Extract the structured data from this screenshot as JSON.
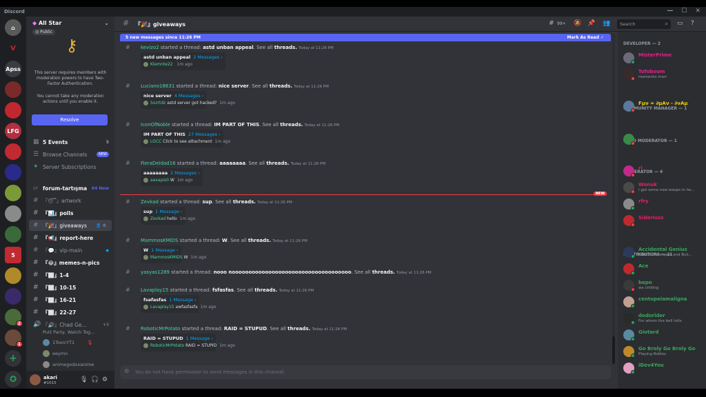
{
  "window": {
    "title": "Discord",
    "controls": [
      "—",
      "☐",
      "✕"
    ]
  },
  "server": {
    "name": "All Star",
    "visibility": "Public"
  },
  "rail": [
    {
      "label": "",
      "color": "#5a5a5a",
      "icon": "server-logo-icon"
    },
    {
      "label": "Apss",
      "color": "#3a3c42"
    },
    {
      "label": "",
      "color": "#7a2a2a"
    },
    {
      "label": "",
      "color": "#c0282f"
    },
    {
      "label": "LFG",
      "color": "#b03040"
    },
    {
      "label": "",
      "color": "#c02a30"
    },
    {
      "label": "",
      "color": "#2a2a8a"
    },
    {
      "label": "",
      "color": "#7a9a3a"
    },
    {
      "label": "",
      "color": "#8a8a8a"
    },
    {
      "label": "",
      "color": "#3a6a3a"
    },
    {
      "label": "5",
      "color": "#c02a30"
    },
    {
      "label": "",
      "color": "#b08a2a"
    },
    {
      "label": "",
      "color": "#3a2a6a"
    },
    {
      "label": "",
      "color": "#4a6a3a"
    },
    {
      "label": "",
      "color": "#6a4a3a"
    }
  ],
  "notice": {
    "text1": "This server requires members with moderation powers to have Two-Factor Authentication.",
    "text2": "You cannot take any moderation actions until you enable it.",
    "button": "Resolve"
  },
  "channels": {
    "events": {
      "label": "5 Events",
      "count": "5"
    },
    "browse": {
      "label": "Browse Channels",
      "tag": "NEW"
    },
    "subs": {
      "label": "Server Subscriptions"
    },
    "list": [
      {
        "name": "forum-tartışma",
        "tag": "64 New"
      },
      {
        "name": "『😴』artwork"
      },
      {
        "name": "『📊』polls"
      },
      {
        "name": "『🎉』giveaways"
      },
      {
        "name": "『📢』report-here"
      },
      {
        "name": "『💬』vip-main"
      },
      {
        "name": "『😂』memes-n-pics"
      },
      {
        "name": "『⬜』1-4"
      },
      {
        "name": "『⬜』10-15"
      },
      {
        "name": "『⬜』16-21"
      },
      {
        "name": "『⬜』22-27"
      },
      {
        "name": "『🔊』Chad Ge..."
      }
    ],
    "voice_sub": "Putt Party, Watch Tog...",
    "voice_count": "+3",
    "voice_users": [
      "1ToxicYT1",
      "eeymn",
      "animegodxxanime"
    ]
  },
  "user": {
    "name": "akari",
    "tag": "#1015"
  },
  "chat": {
    "channel": "『🎉』giveaways",
    "header_badge": "99+",
    "search_placeholder": "Search",
    "new_messages": "5 new messages since 11:26 PM",
    "mark_read": "Mark As Read",
    "composer_placeholder": "You do not have permission to send messages in this channel.",
    "new_divider": "NEW",
    "messages": [
      {
        "user": "kevizo2",
        "thread": "astd unban appeal",
        "card_title": "astd unban appeal",
        "count": "2 Messages ›",
        "last_user": "Klemnte22",
        "last_text": "",
        "last_time": "1m ago"
      },
      {
        "user": "Luciano18631",
        "thread": "nice server",
        "card_title": "nice server",
        "count": "4 Messages ›",
        "last_user": "Sxzrtdz",
        "last_text": "astd server got hacked?",
        "last_time": "1m ago"
      },
      {
        "user": "IconOfNoble",
        "thread": "IM PART OF THIS",
        "card_title": "IM PART OF THIS",
        "count": "27 Messages ›",
        "last_user": "LOCC",
        "last_text": "Click to see attachment",
        "last_time": "1m ago"
      },
      {
        "user": "FieraDeidad16",
        "thread": "aaaaaaaa",
        "card_title": "aaaaaaaa",
        "count": "2 Messages ›",
        "last_user": "aaxapis0",
        "last_text": "W",
        "last_time": "1m ago"
      },
      {
        "user": "Zevkad",
        "thread": "sup",
        "card_title": "sup",
        "count": "1 Message ›",
        "last_user": "Zevkad",
        "last_text": "hello",
        "last_time": "1m ago"
      },
      {
        "user": "MammosKMIDS",
        "thread": "W",
        "card_title": "W",
        "count": "1 Message ›",
        "last_user": "MammosKMIDS",
        "last_text": "W",
        "last_time": "1m ago"
      },
      {
        "user": "yasyas1289",
        "thread": "nooo noooooooooooooooooooooooooooooooooooo",
        "card_title": "",
        "count": "",
        "last_user": "",
        "last_text": "",
        "last_time": ""
      },
      {
        "user": "Lavaplay15",
        "thread": "fsfasfas",
        "card_title": "fsafasfas",
        "count": "1 Message ›",
        "last_user": "Lavaplay15",
        "last_text": "awfasfasfa",
        "last_time": "1m ago"
      },
      {
        "user": "RoboticMrPotato",
        "thread": "RAID = STUPUD",
        "card_title": "RAID = STUPUD",
        "count": "1 Message ›",
        "last_user": "RoboticMrPotato",
        "last_text": "RAID = STUPID",
        "last_time": "1m ago"
      }
    ],
    "started": "started a thread:",
    "see_all": "See all",
    "threads": "threads.",
    "timestamp": "Today at 11:26 PM"
  },
  "members": {
    "categories": {
      "developer": "DEVELOPER — 2",
      "community": "COMMUNITY MANAGER — 1",
      "head_mod": "HEAD MODERATOR — 1",
      "moderator": "MODERATOR — 4",
      "contributors": "CONTRIBUTORS — 21"
    },
    "list": [
      {
        "name": "MisterPrime",
        "status": "",
        "color": "#e91e8c",
        "av": "#6a6a7a"
      },
      {
        "name": "Tofoboom",
        "status": "memento mori",
        "color": "#e91e8c",
        "av": "#3a2a2a"
      },
      {
        "name": "Fμν = ∂μAν - ∂νAμ",
        "status": "",
        "color": "#f0d000",
        "av": "#5a7a9a"
      },
      {
        "name": "",
        "status": "",
        "color": "#e91e8c",
        "av": "#3a8a4a"
      },
      {
        "name": "ri",
        "status": "",
        "color": "#e91e63",
        "av": "#c02a8a"
      },
      {
        "name": "Wonuk ",
        "status": "I got some new wasps in he...",
        "color": "#e91e63",
        "av": "#4a4a4a"
      },
      {
        "name": "rfry",
        "status": "",
        "color": "#e91e63",
        "av": "#8a8a8a"
      },
      {
        "name": "Sideriuss",
        "status": "",
        "color": "#e91e63",
        "av": "#c0282f"
      },
      {
        "name": "Accidental Genius",
        "status": "Roblox Developer and Buil...",
        "color": "#3ba55d",
        "av": "#2a3a5a"
      },
      {
        "name": "Ace",
        "status": "",
        "color": "#3ba55d",
        "av": "#c0282f"
      },
      {
        "name": "bepo",
        "status": "we chilling",
        "color": "#3ba55d",
        "av": "#3a3a3a"
      },
      {
        "name": "centopeiamaligna",
        "status": "",
        "color": "#3ba55d",
        "av": "#c0a090"
      },
      {
        "name": "dodorider",
        "status": "For whom the bell tolls",
        "color": "#3ba55d",
        "av": "#2a2a2a"
      },
      {
        "name": "Giotard",
        "status": "",
        "color": "#3ba55d",
        "av": "#5a8aa0"
      },
      {
        "name": "Go Broly Go Broly Go",
        "status": "Playing Roblox",
        "color": "#3ba55d",
        "av": "#c08a2a"
      },
      {
        "name": "iDev4You",
        "status": "",
        "color": "#3ba55d",
        "av": "#e0a0c0"
      },
      {
        "name": "IncredibleAyum",
        "status": "Masanori",
        "color": "#3ba55d",
        "av": "#6a4a8a"
      }
    ]
  }
}
